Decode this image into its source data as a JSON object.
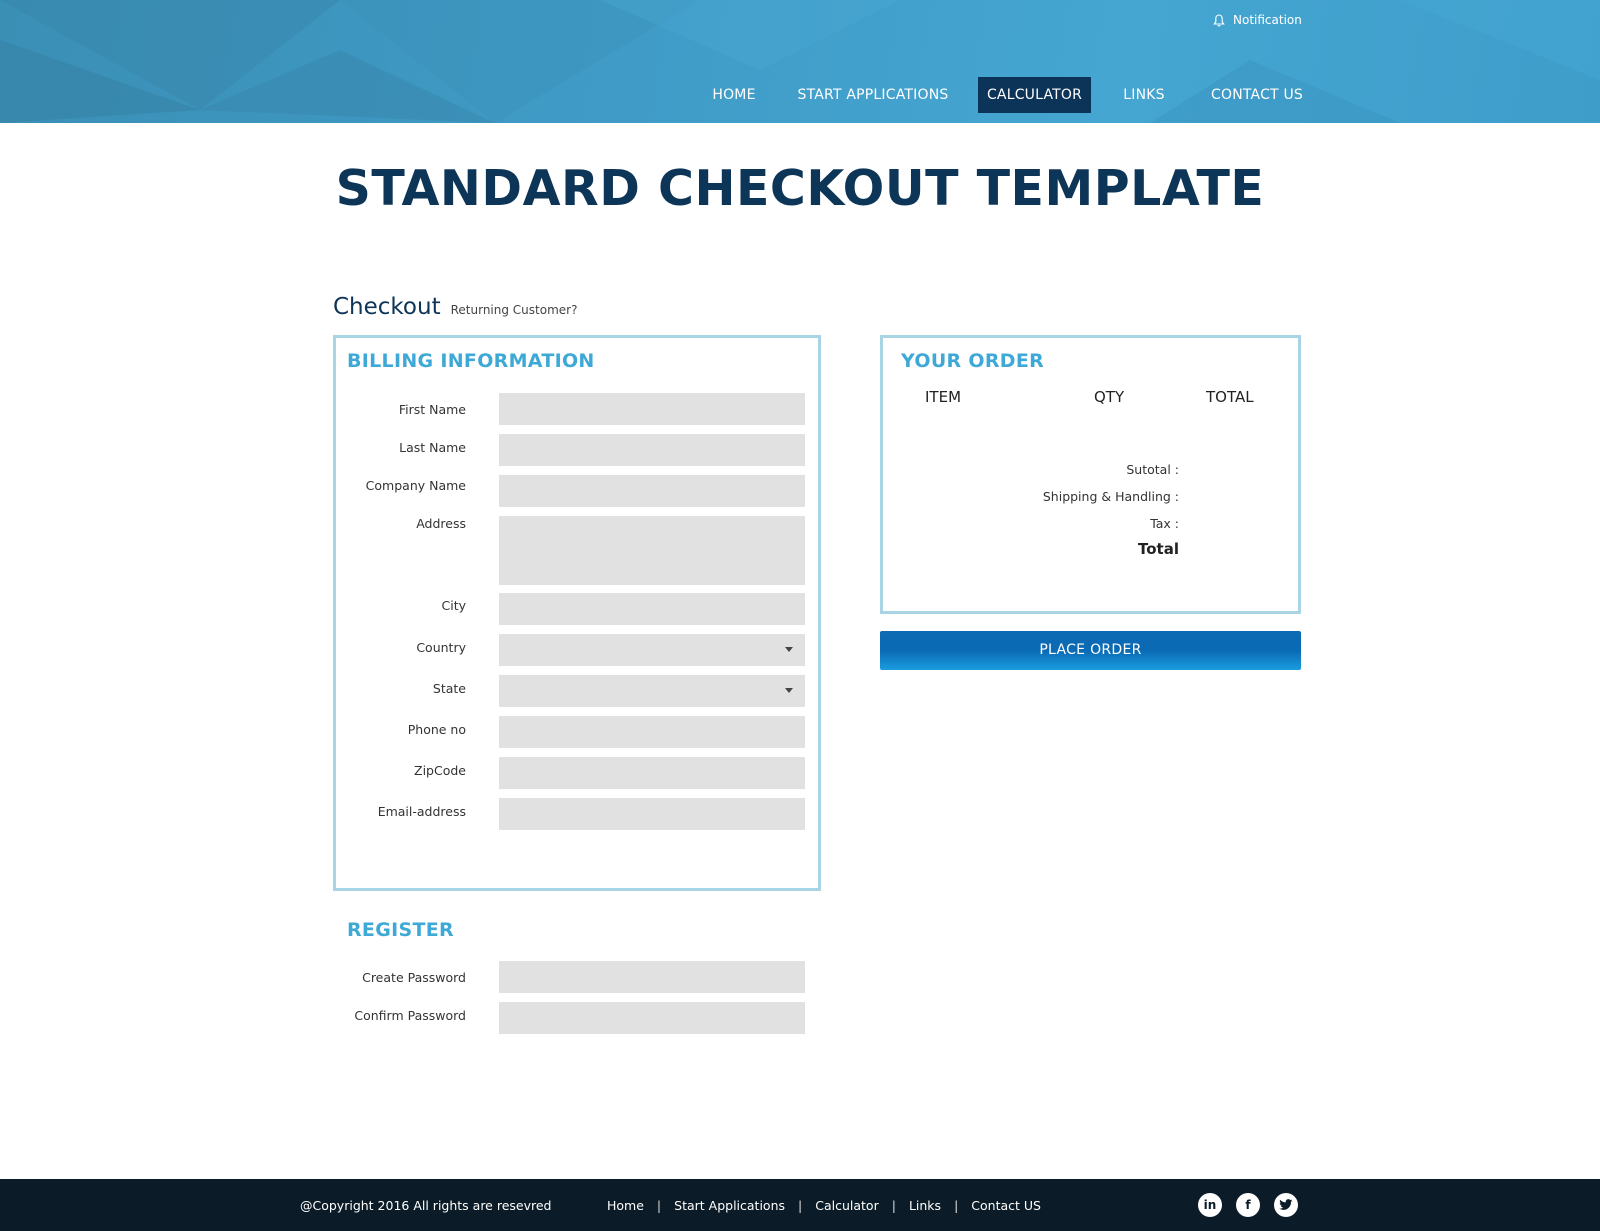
{
  "header": {
    "notification_label": "Notification",
    "nav": [
      {
        "label": "HOME"
      },
      {
        "label": "START APPLICATIONS"
      },
      {
        "label": "CALCULATOR",
        "active": true
      },
      {
        "label": "LINKS"
      },
      {
        "label": "CONTACT US"
      }
    ]
  },
  "page": {
    "title": "STANDARD CHECKOUT TEMPLATE",
    "checkout_heading": "Checkout",
    "returning_customer": "Returning Customer?"
  },
  "billing": {
    "title": "BILLING INFORMATION",
    "fields": [
      {
        "label": "First Name",
        "value": ""
      },
      {
        "label": "Last Name",
        "value": ""
      },
      {
        "label": "Company Name",
        "value": ""
      },
      {
        "label": "Address",
        "value": ""
      },
      {
        "label": "City",
        "value": ""
      },
      {
        "label": "Country",
        "value": ""
      },
      {
        "label": "State",
        "value": ""
      },
      {
        "label": "Phone no",
        "value": ""
      },
      {
        "label": "ZipCode",
        "value": ""
      },
      {
        "label": "Email-address",
        "value": ""
      }
    ]
  },
  "register": {
    "title": "REGISTER",
    "fields": [
      {
        "label": "Create Password",
        "value": ""
      },
      {
        "label": "Confirm Password",
        "value": ""
      }
    ]
  },
  "order": {
    "title": "YOUR ORDER",
    "columns": [
      "ITEM",
      "QTY",
      "TOTAL"
    ],
    "subtotal_label": "Sutotal :",
    "shipping_label": "Shipping & Handling :",
    "tax_label": "Tax :",
    "total_label": "Total",
    "place_order_label": "PLACE ORDER"
  },
  "footer": {
    "copyright": "@Copyright 2016 All rights are resevred",
    "links": [
      "Home",
      "Start Applications",
      "Calculator",
      "Links",
      "Contact US"
    ],
    "social": [
      "linkedin-icon",
      "facebook-icon",
      "twitter-icon"
    ]
  },
  "colors": {
    "header_blue": "#40a0cc",
    "nav_active": "#0c3358",
    "title_navy": "#0d3557",
    "section_blue": "#3ea9d6",
    "panel_border": "#a9d4e4",
    "input_gray": "#e1e1e1",
    "button_blue": "#0a6ab4",
    "footer_bg": "#0b1c28"
  }
}
